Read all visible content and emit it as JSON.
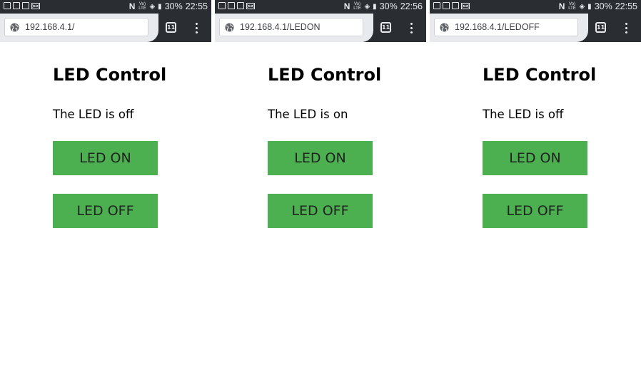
{
  "colors": {
    "status_bar_bg": "#2a2e33",
    "button_bg": "#4caf50",
    "button_text": "#222222"
  },
  "screens": [
    {
      "status_bar": {
        "battery": "30%",
        "time": "22:55"
      },
      "url": "192.168.4.1/",
      "tab_count": "11",
      "page": {
        "heading": "LED Control",
        "status": "The LED is off",
        "on_button": "LED ON",
        "off_button": "LED OFF"
      }
    },
    {
      "status_bar": {
        "battery": "30%",
        "time": "22:56"
      },
      "url": "192.168.4.1/LEDON",
      "tab_count": "11",
      "page": {
        "heading": "LED Control",
        "status": "The LED is on",
        "on_button": "LED ON",
        "off_button": "LED OFF"
      }
    },
    {
      "status_bar": {
        "battery": "30%",
        "time": "22:55"
      },
      "url": "192.168.4.1/LEDOFF",
      "tab_count": "11",
      "page": {
        "heading": "LED Control",
        "status": "The LED is off",
        "on_button": "LED ON",
        "off_button": "LED OFF"
      }
    }
  ]
}
